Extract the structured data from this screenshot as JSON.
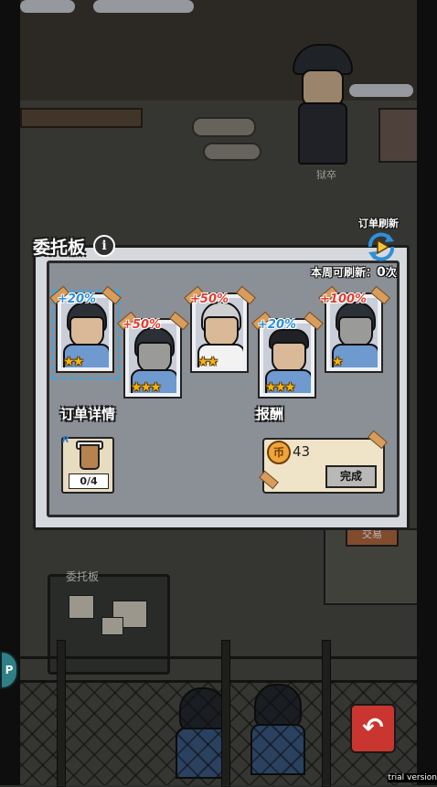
{
  "scene": {
    "guard_label": "狱卒",
    "board_label": "委托板",
    "shop_label": "交易",
    "side_tab_label": "P",
    "back_button_label": "↶",
    "watermark": "trial version"
  },
  "panel": {
    "title": "委托板",
    "info_icon": "i",
    "refresh_label": "订单刷新",
    "refresh_count_prefix": "本周可刷新：",
    "refresh_count_value": "0",
    "refresh_count_unit": "次",
    "order_details_label": "订单详情",
    "reward_label": "报酬"
  },
  "cards": [
    {
      "bonus": "+20%",
      "bonus_color": "blue",
      "stars": "★★",
      "star_count": 2,
      "selected": true
    },
    {
      "bonus": "+50%",
      "bonus_color": "red",
      "stars": "★★★",
      "star_count": 3,
      "selected": false
    },
    {
      "bonus": "+50%",
      "bonus_color": "red",
      "stars": "★★",
      "star_count": 2,
      "selected": false
    },
    {
      "bonus": "+20%",
      "bonus_color": "blue",
      "stars": "★★★",
      "star_count": 3,
      "selected": false
    },
    {
      "bonus": "+100%",
      "bonus_color": "red",
      "stars": "★",
      "star_count": 1,
      "selected": false
    }
  ],
  "order_item": {
    "rarity": "R",
    "icon": "milk-tea-icon",
    "progress": "0/4"
  },
  "reward": {
    "coin_icon": "币",
    "amount": "43",
    "complete_label": "完成"
  },
  "colors": {
    "accent_blue": "#2f8fd8",
    "accent_red": "#e23d2f",
    "star_gold": "#f3b21a"
  }
}
